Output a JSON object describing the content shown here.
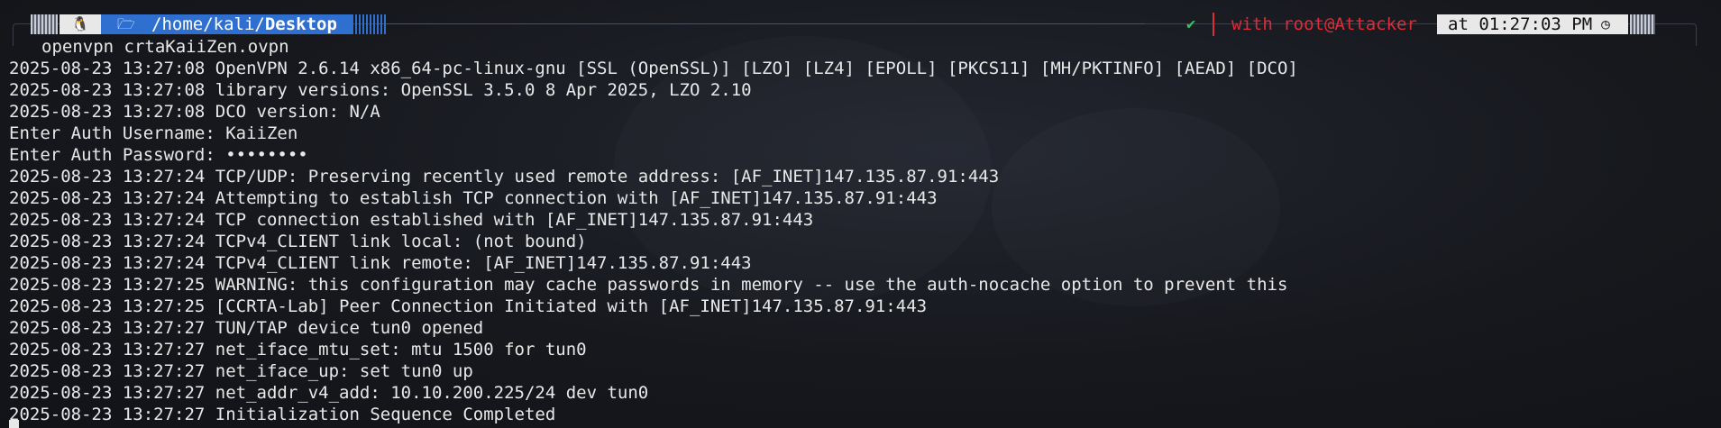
{
  "prompt": {
    "os_icon": "🐧",
    "folder_icon": "folder-open-icon",
    "path_prefix": "/home/kali/",
    "path_current": "Desktop",
    "status_ok": "✔",
    "user_info": "with root@Attacker",
    "time_text": "at 01:27:03 PM",
    "clock_icon": "◷"
  },
  "colors": {
    "path_bg": "#2f6fd0",
    "status_ok": "#3fbf66",
    "user_info": "#e02b39",
    "segment_bg": "#e8e8e8"
  },
  "command": "openvpn crtaKaiiZen.ovpn",
  "output_lines": [
    "2025-08-23 13:27:08 OpenVPN 2.6.14 x86_64-pc-linux-gnu [SSL (OpenSSL)] [LZO] [LZ4] [EPOLL] [PKCS11] [MH/PKTINFO] [AEAD] [DCO]",
    "2025-08-23 13:27:08 library versions: OpenSSL 3.5.0 8 Apr 2025, LZO 2.10",
    "2025-08-23 13:27:08 DCO version: N/A",
    "Enter Auth Username: KaiiZen",
    "Enter Auth Password: ••••••••",
    "2025-08-23 13:27:24 TCP/UDP: Preserving recently used remote address: [AF_INET]147.135.87.91:443",
    "2025-08-23 13:27:24 Attempting to establish TCP connection with [AF_INET]147.135.87.91:443",
    "2025-08-23 13:27:24 TCP connection established with [AF_INET]147.135.87.91:443",
    "2025-08-23 13:27:24 TCPv4_CLIENT link local: (not bound)",
    "2025-08-23 13:27:24 TCPv4_CLIENT link remote: [AF_INET]147.135.87.91:443",
    "2025-08-23 13:27:25 WARNING: this configuration may cache passwords in memory -- use the auth-nocache option to prevent this",
    "2025-08-23 13:27:25 [CCRTA-Lab] Peer Connection Initiated with [AF_INET]147.135.87.91:443",
    "2025-08-23 13:27:27 TUN/TAP device tun0 opened",
    "2025-08-23 13:27:27 net_iface_mtu_set: mtu 1500 for tun0",
    "2025-08-23 13:27:27 net_iface_up: set tun0 up",
    "2025-08-23 13:27:27 net_addr_v4_add: 10.10.200.225/24 dev tun0",
    "2025-08-23 13:27:27 Initialization Sequence Completed"
  ]
}
